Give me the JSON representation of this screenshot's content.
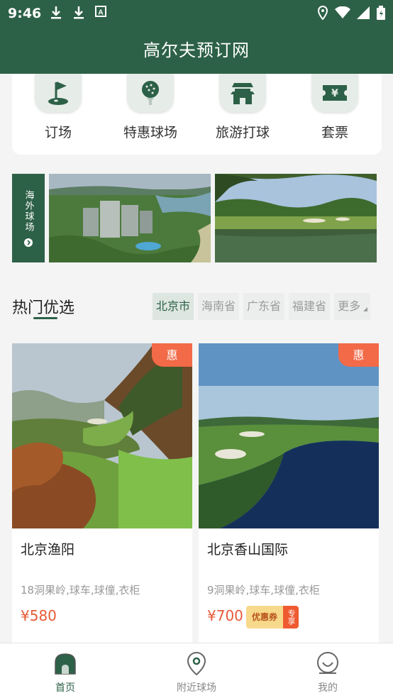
{
  "status_bar": {
    "time": "9:46"
  },
  "header": {
    "title": "高尔夫预订网"
  },
  "categories": [
    {
      "label": "订场",
      "icon": "golf-flag-icon"
    },
    {
      "label": "特惠球场",
      "icon": "golf-ball-tee-icon"
    },
    {
      "label": "旅游打球",
      "icon": "pagoda-icon"
    },
    {
      "label": "套票",
      "icon": "ticket-icon"
    }
  ],
  "banner": {
    "overseas_label": "海外球场"
  },
  "hot": {
    "title": "热门优选",
    "provinces": [
      "北京市",
      "海南省",
      "广东省",
      "福建省",
      "更多"
    ]
  },
  "courses": [
    {
      "name": "北京渔阳",
      "desc": "18洞果岭,球车,球僮,衣柜",
      "price": "¥580",
      "badge": "惠"
    },
    {
      "name": "北京香山国际",
      "desc": "9洞果岭,球车,球僮,衣柜",
      "price": "¥700",
      "badge": "惠",
      "coupon": "优惠券",
      "coupon_tail": "专享"
    }
  ],
  "nav": [
    {
      "label": "首页",
      "icon": "home-icon"
    },
    {
      "label": "附近球场",
      "icon": "location-pin-icon"
    },
    {
      "label": "我的",
      "icon": "profile-icon"
    }
  ],
  "colors": {
    "brand": "#2d6147",
    "accent": "#f26a47",
    "price": "#e85a38"
  }
}
